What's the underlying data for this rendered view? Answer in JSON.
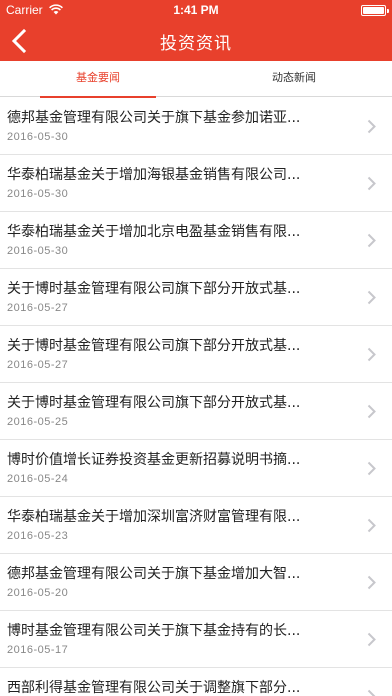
{
  "status_bar": {
    "carrier": "Carrier",
    "time": "1:41 PM"
  },
  "nav": {
    "title": "投资资讯",
    "back_icon": "chevron-left-icon"
  },
  "tabs": [
    {
      "label": "基金要闻",
      "active": true
    },
    {
      "label": "动态新闻",
      "active": false
    }
  ],
  "news": [
    {
      "title": "德邦基金管理有限公司关于旗下基金参加诺亚...",
      "date": "2016-05-30"
    },
    {
      "title": "华泰柏瑞基金关于增加海银基金销售有限公司...",
      "date": "2016-05-30"
    },
    {
      "title": "华泰柏瑞基金关于增加北京电盈基金销售有限...",
      "date": "2016-05-30"
    },
    {
      "title": "关于博时基金管理有限公司旗下部分开放式基...",
      "date": "2016-05-27"
    },
    {
      "title": "关于博时基金管理有限公司旗下部分开放式基...",
      "date": "2016-05-27"
    },
    {
      "title": "关于博时基金管理有限公司旗下部分开放式基...",
      "date": "2016-05-25"
    },
    {
      "title": "博时价值增长证券投资基金更新招募说明书摘...",
      "date": "2016-05-24"
    },
    {
      "title": "华泰柏瑞基金关于增加深圳富济财富管理有限...",
      "date": "2016-05-23"
    },
    {
      "title": "德邦基金管理有限公司关于旗下基金增加大智...",
      "date": "2016-05-20"
    },
    {
      "title": "博时基金管理有限公司关于旗下基金持有的长...",
      "date": "2016-05-17"
    },
    {
      "title": "西部利得基金管理有限公司关于调整旗下部分...",
      "date": ""
    }
  ],
  "colors": {
    "accent": "#e8402c",
    "text": "#222222",
    "date": "#888888",
    "chevron": "#c7c7cc"
  }
}
